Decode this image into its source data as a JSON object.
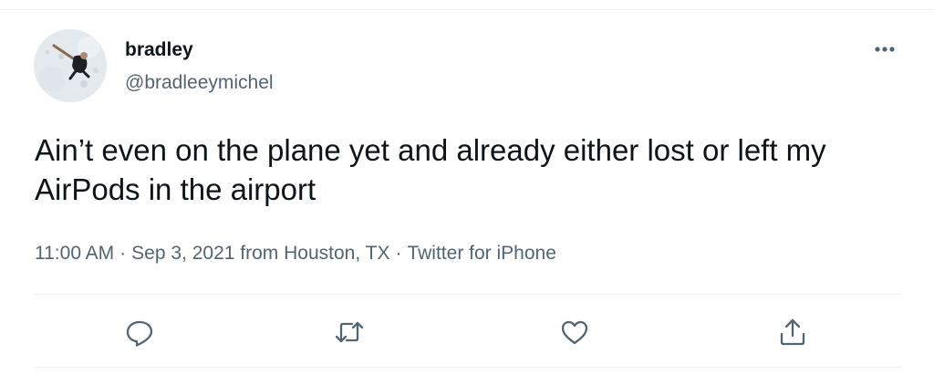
{
  "author": {
    "display_name": "bradley",
    "handle": "@bradleeymichel",
    "avatar_icon": "avatar-photo"
  },
  "tweet": {
    "text": "Ain’t even on the plane yet and already either lost or left my AirPods in the airport",
    "time": "11:00 AM",
    "date": "Sep 3, 2021",
    "location": "from Houston, TX",
    "source": "Twitter for iPhone",
    "separator": "·"
  },
  "actions": [
    {
      "icon": "reply-icon"
    },
    {
      "icon": "retweet-icon"
    },
    {
      "icon": "like-icon"
    },
    {
      "icon": "share-icon"
    }
  ],
  "colors": {
    "text_primary": "#0f1419",
    "text_secondary": "#536471",
    "divider": "#eff3f4"
  }
}
